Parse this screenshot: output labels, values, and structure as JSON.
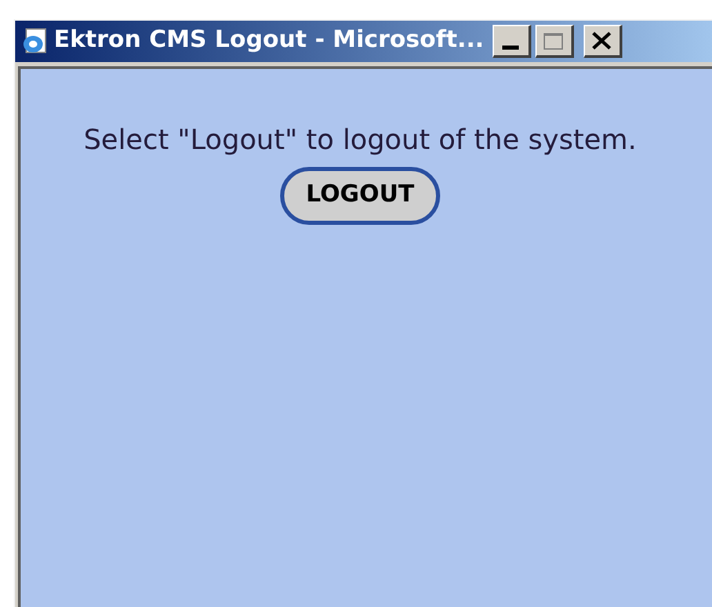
{
  "window": {
    "title": "Ektron CMS Logout - Microsoft..."
  },
  "message": "Select \"Logout\" to logout of the system.",
  "buttons": [
    {
      "label": "LOGOUT"
    }
  ]
}
